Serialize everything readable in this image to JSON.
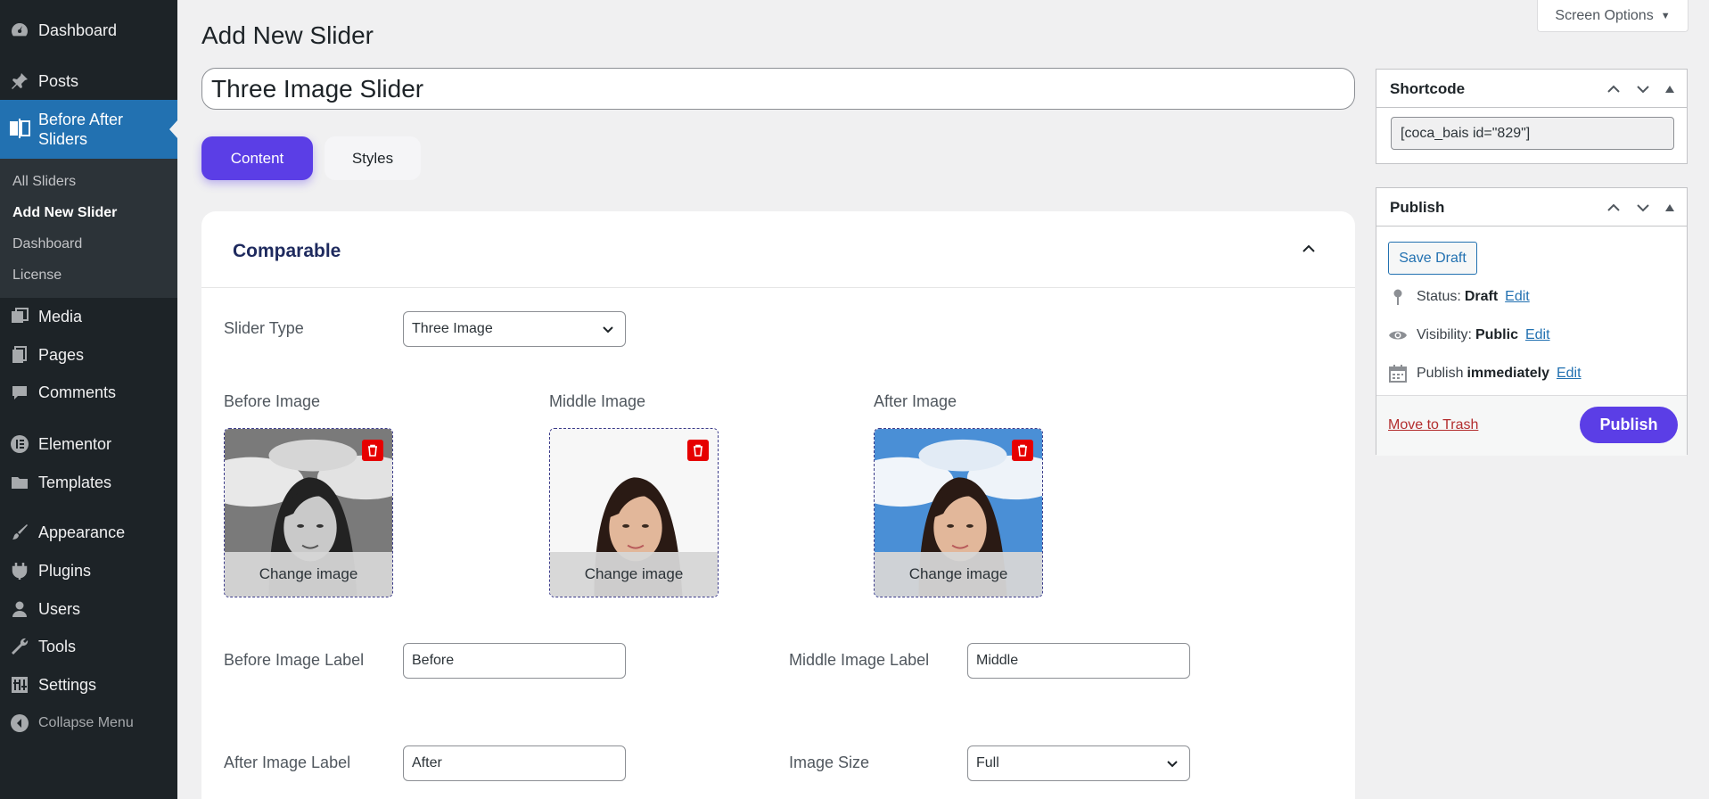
{
  "sidebar": {
    "items": [
      {
        "label": "Dashboard",
        "icon": "dashboard-icon"
      },
      {
        "label": "Posts",
        "icon": "pin-icon"
      },
      {
        "label": "Before After Sliders",
        "icon": "before-after-icon"
      },
      {
        "label": "Media",
        "icon": "media-icon"
      },
      {
        "label": "Pages",
        "icon": "pages-icon"
      },
      {
        "label": "Comments",
        "icon": "comments-icon"
      },
      {
        "label": "Elementor",
        "icon": "elementor-icon"
      },
      {
        "label": "Templates",
        "icon": "folder-icon"
      },
      {
        "label": "Appearance",
        "icon": "brush-icon"
      },
      {
        "label": "Plugins",
        "icon": "plugin-icon"
      },
      {
        "label": "Users",
        "icon": "user-icon"
      },
      {
        "label": "Tools",
        "icon": "wrench-icon"
      },
      {
        "label": "Settings",
        "icon": "settings-icon"
      }
    ],
    "before_after_line1": "Before After",
    "before_after_line2": "Sliders",
    "submenu": [
      "All Sliders",
      "Add New Slider",
      "Dashboard",
      "License"
    ],
    "collapse_label": "Collapse Menu"
  },
  "header": {
    "title": "Add New Slider",
    "screen_options": "Screen Options"
  },
  "title_input": {
    "value": "Three Image Slider"
  },
  "tabs": {
    "content": "Content",
    "styles": "Styles"
  },
  "panel": {
    "title": "Comparable",
    "slider_type_label": "Slider Type",
    "slider_type_value": "Three Image",
    "images": [
      {
        "label": "Before Image",
        "button": "Change image",
        "style": "grayscale"
      },
      {
        "label": "Middle Image",
        "button": "Change image",
        "style": "cutout"
      },
      {
        "label": "After Image",
        "button": "Change image",
        "style": "color"
      }
    ],
    "before_label_label": "Before Image Label",
    "before_label_value": "Before",
    "middle_label_label": "Middle Image Label",
    "middle_label_value": "Middle",
    "after_label_label": "After Image Label",
    "after_label_value": "After",
    "image_size_label": "Image Size",
    "image_size_value": "Full"
  },
  "shortcode": {
    "title": "Shortcode",
    "value": "[coca_bais id=\"829\"]"
  },
  "publish": {
    "title": "Publish",
    "save_draft": "Save Draft",
    "status_label": "Status:",
    "status_value": "Draft",
    "visibility_label": "Visibility:",
    "visibility_value": "Public",
    "publish_label": "Publish",
    "publish_value": "immediately",
    "edit": "Edit",
    "move_to_trash": "Move to Trash",
    "publish_button": "Publish"
  },
  "colors": {
    "sidebar_bg": "#1d2327",
    "active_menu": "#2271b1",
    "accent": "#5b3ee6",
    "trash_red": "#e60000"
  }
}
